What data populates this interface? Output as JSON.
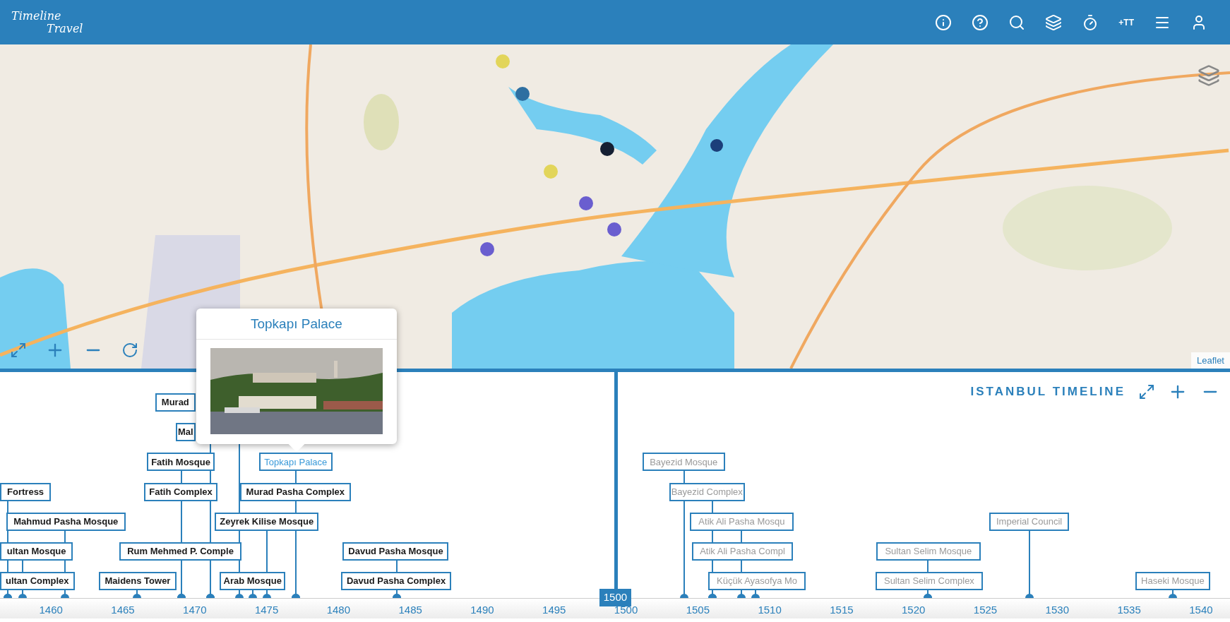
{
  "header": {
    "logo": [
      "Timeline",
      "Travel"
    ],
    "toolbar": [
      {
        "kind": "info"
      },
      {
        "kind": "help"
      },
      {
        "kind": "search"
      },
      {
        "kind": "layers"
      },
      {
        "kind": "timer"
      },
      {
        "kind": "text",
        "label": "+TT"
      },
      {
        "kind": "menu"
      },
      {
        "kind": "user"
      }
    ]
  },
  "map": {
    "attribution": "Leaflet",
    "popup": {
      "title": "Topkapı Palace"
    }
  },
  "timeline": {
    "title": "ISTANBUL TIMELINE",
    "cursor": "1500",
    "events": [
      {
        "label": "Murad",
        "selected": false,
        "faded": false
      },
      {
        "label": "Mal",
        "selected": false,
        "faded": false
      },
      {
        "label": "Fatih Mosque",
        "selected": false,
        "faded": false
      },
      {
        "label": "Topkapı Palace",
        "selected": true,
        "faded": false
      },
      {
        "label": "Bayezid Mosque",
        "selected": false,
        "faded": true
      },
      {
        "label": "Fortress",
        "selected": false,
        "faded": false
      },
      {
        "label": "Fatih Complex",
        "selected": false,
        "faded": false
      },
      {
        "label": "Murad Pasha Complex",
        "selected": false,
        "faded": false
      },
      {
        "label": "Bayezid Complex",
        "selected": false,
        "faded": true
      },
      {
        "label": "Mahmud Pasha Mosque",
        "selected": false,
        "faded": false
      },
      {
        "label": "Zeyrek Kilise Mosque",
        "selected": false,
        "faded": false
      },
      {
        "label": "Atik Ali Pasha Mosqu",
        "selected": false,
        "faded": true
      },
      {
        "label": "Imperial Council",
        "selected": false,
        "faded": true
      },
      {
        "label": "ultan Mosque",
        "selected": false,
        "faded": false
      },
      {
        "label": "Rum Mehmed P. Comple",
        "selected": false,
        "faded": false
      },
      {
        "label": "Davud Pasha Mosque",
        "selected": false,
        "faded": false
      },
      {
        "label": "Atik Ali Pasha Compl",
        "selected": false,
        "faded": true
      },
      {
        "label": "Sultan Selim Mosque",
        "selected": false,
        "faded": true
      },
      {
        "label": "ultan Complex",
        "selected": false,
        "faded": false
      },
      {
        "label": "Maidens Tower",
        "selected": false,
        "faded": false
      },
      {
        "label": "Arab Mosque",
        "selected": false,
        "faded": false
      },
      {
        "label": "Davud Pasha Complex",
        "selected": false,
        "faded": false
      },
      {
        "label": "Küçük Ayasofya Mo",
        "selected": false,
        "faded": true
      },
      {
        "label": "Sultan Selim Complex",
        "selected": false,
        "faded": true
      },
      {
        "label": "Haseki Mosque",
        "selected": false,
        "faded": true
      }
    ],
    "years": [
      "1460",
      "1465",
      "1470",
      "1475",
      "1480",
      "1485",
      "1490",
      "1495",
      "1500",
      "1505",
      "1510",
      "1515",
      "1520",
      "1525",
      "1530",
      "1535",
      "1540"
    ]
  }
}
